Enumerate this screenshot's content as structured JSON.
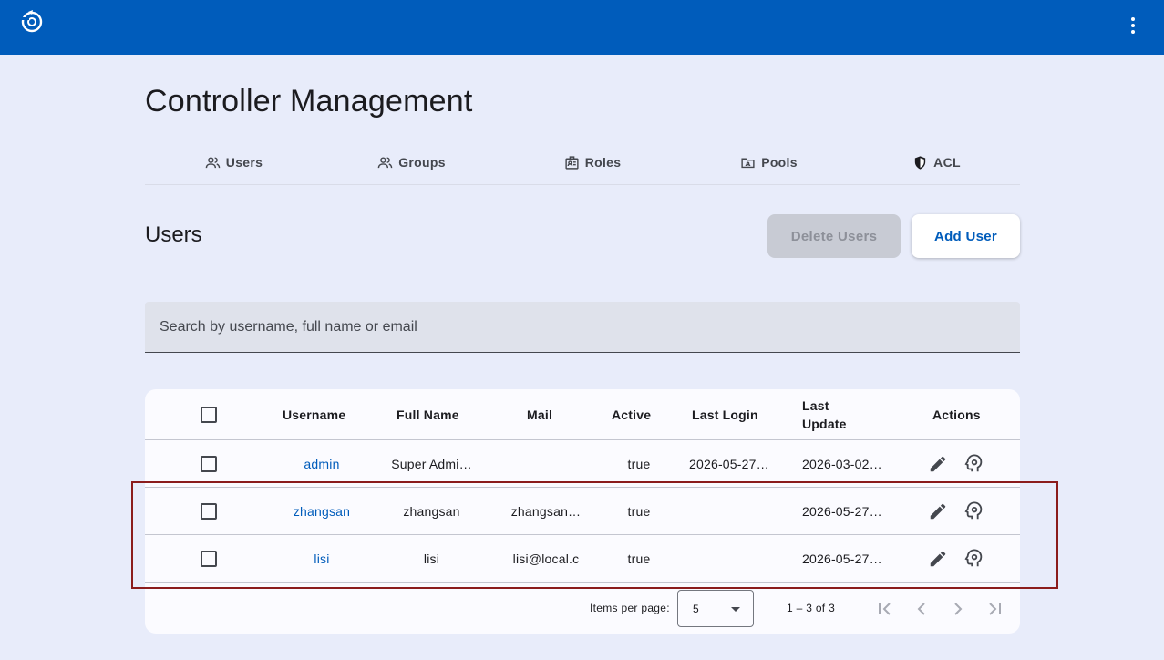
{
  "header": {
    "logo_icon": "app-logo-icon",
    "menu_icon": "more-vert-icon",
    "bar_color": "#005cbb"
  },
  "page": {
    "title": "Controller Management"
  },
  "tabs": [
    {
      "label": "Users",
      "icon": "users-icon"
    },
    {
      "label": "Groups",
      "icon": "groups-icon"
    },
    {
      "label": "Roles",
      "icon": "roles-icon"
    },
    {
      "label": "Pools",
      "icon": "pools-icon"
    },
    {
      "label": "ACL",
      "icon": "shield-icon"
    }
  ],
  "section": {
    "title": "Users",
    "delete_label": "Delete Users",
    "add_label": "Add User"
  },
  "search": {
    "placeholder": "Search by username, full name or email",
    "value": ""
  },
  "table": {
    "columns": [
      "Username",
      "Full Name",
      "Mail",
      "Active",
      "Last Login",
      "Last Update",
      "Actions"
    ],
    "rows": [
      {
        "username": "admin",
        "full_name": "Super Admi…",
        "mail": "",
        "active": "true",
        "last_login": "2026-05-27…",
        "last_update": "2026-03-02…"
      },
      {
        "username": "zhangsan",
        "full_name": "zhangsan",
        "mail": "zhangsan…",
        "active": "true",
        "last_login": "",
        "last_update": "2026-05-27…"
      },
      {
        "username": "lisi",
        "full_name": "lisi",
        "mail": "lisi@local.c",
        "active": "true",
        "last_login": "",
        "last_update": "2026-05-27…"
      }
    ]
  },
  "paginator": {
    "items_per_page_label": "Items per page:",
    "page_size": "5",
    "range_label": "1 – 3 of 3"
  }
}
